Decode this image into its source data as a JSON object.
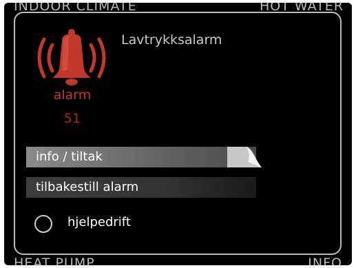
{
  "background_labels": {
    "top_left": "INDOOR CLIMATE",
    "top_right": "HOT WATER",
    "bottom_left": "HEAT PUMP",
    "bottom_right": "INFO"
  },
  "alarm": {
    "title": "Lavtrykksalarm",
    "status_word": "alarm",
    "code": "51",
    "icon": "bell-alarm-icon",
    "color": "#c0392b"
  },
  "menu": {
    "items": [
      {
        "label": "info / tiltak",
        "selected": true
      },
      {
        "label": "tilbakestill alarm",
        "selected": false
      }
    ],
    "option": {
      "label": "hjelpedrift",
      "checked": false
    }
  }
}
